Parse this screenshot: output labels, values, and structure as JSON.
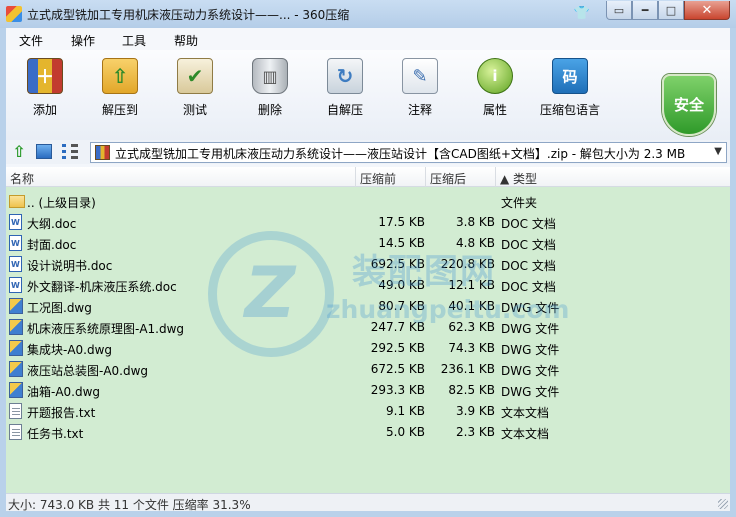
{
  "window": {
    "title": "立式成型铣加工专用机床液压动力系统设计——... - 360压缩"
  },
  "menu": [
    "文件",
    "操作",
    "工具",
    "帮助"
  ],
  "toolbar": {
    "items": [
      {
        "label": "添加",
        "icon": "add-archive-icon"
      },
      {
        "label": "解压到",
        "icon": "extract-icon"
      },
      {
        "label": "测试",
        "icon": "test-icon"
      },
      {
        "label": "删除",
        "icon": "delete-icon"
      },
      {
        "label": "自解压",
        "icon": "sfx-icon"
      },
      {
        "label": "注释",
        "icon": "comment-icon"
      },
      {
        "label": "属性",
        "icon": "properties-icon"
      },
      {
        "label": "压缩包语言",
        "icon": "language-icon"
      }
    ],
    "security_label": "安全",
    "lang_glyph": "码"
  },
  "address": {
    "path": "立式成型铣加工专用机床液压动力系统设计——液压站设计【含CAD图纸+文档】.zip - 解包大小为 2.3 MB"
  },
  "columns": {
    "name": "名称",
    "size": "压缩前",
    "packed": "压缩后",
    "type": "▲ 类型"
  },
  "files": [
    {
      "name": ".. (上级目录)",
      "size": "",
      "packed": "",
      "type": "文件夹",
      "kind": "folder"
    },
    {
      "name": "大纲.doc",
      "size": "17.5 KB",
      "packed": "3.8 KB",
      "type": "DOC 文档",
      "kind": "doc"
    },
    {
      "name": "封面.doc",
      "size": "14.5 KB",
      "packed": "4.8 KB",
      "type": "DOC 文档",
      "kind": "doc"
    },
    {
      "name": "设计说明书.doc",
      "size": "692.5 KB",
      "packed": "220.8 KB",
      "type": "DOC 文档",
      "kind": "doc"
    },
    {
      "name": "外文翻译-机床液压系统.doc",
      "size": "49.0 KB",
      "packed": "12.1 KB",
      "type": "DOC 文档",
      "kind": "doc"
    },
    {
      "name": "工况图.dwg",
      "size": "80.7 KB",
      "packed": "40.1 KB",
      "type": "DWG 文件",
      "kind": "dwg"
    },
    {
      "name": "机床液压系统原理图-A1.dwg",
      "size": "247.7 KB",
      "packed": "62.3 KB",
      "type": "DWG 文件",
      "kind": "dwg"
    },
    {
      "name": "集成块-A0.dwg",
      "size": "292.5 KB",
      "packed": "74.3 KB",
      "type": "DWG 文件",
      "kind": "dwg"
    },
    {
      "name": "液压站总装图-A0.dwg",
      "size": "672.5 KB",
      "packed": "236.1 KB",
      "type": "DWG 文件",
      "kind": "dwg"
    },
    {
      "name": "油箱-A0.dwg",
      "size": "293.3 KB",
      "packed": "82.5 KB",
      "type": "DWG 文件",
      "kind": "dwg"
    },
    {
      "name": "开题报告.txt",
      "size": "9.1 KB",
      "packed": "3.9 KB",
      "type": "文本文档",
      "kind": "txt"
    },
    {
      "name": "任务书.txt",
      "size": "5.0 KB",
      "packed": "2.3 KB",
      "type": "文本文档",
      "kind": "txt"
    }
  ],
  "watermark": {
    "cn": "装配图网",
    "en": "zhuangpeitu.com"
  },
  "status": {
    "text": "大小: 743.0 KB 共 11 个文件 压缩率 31.3%"
  }
}
